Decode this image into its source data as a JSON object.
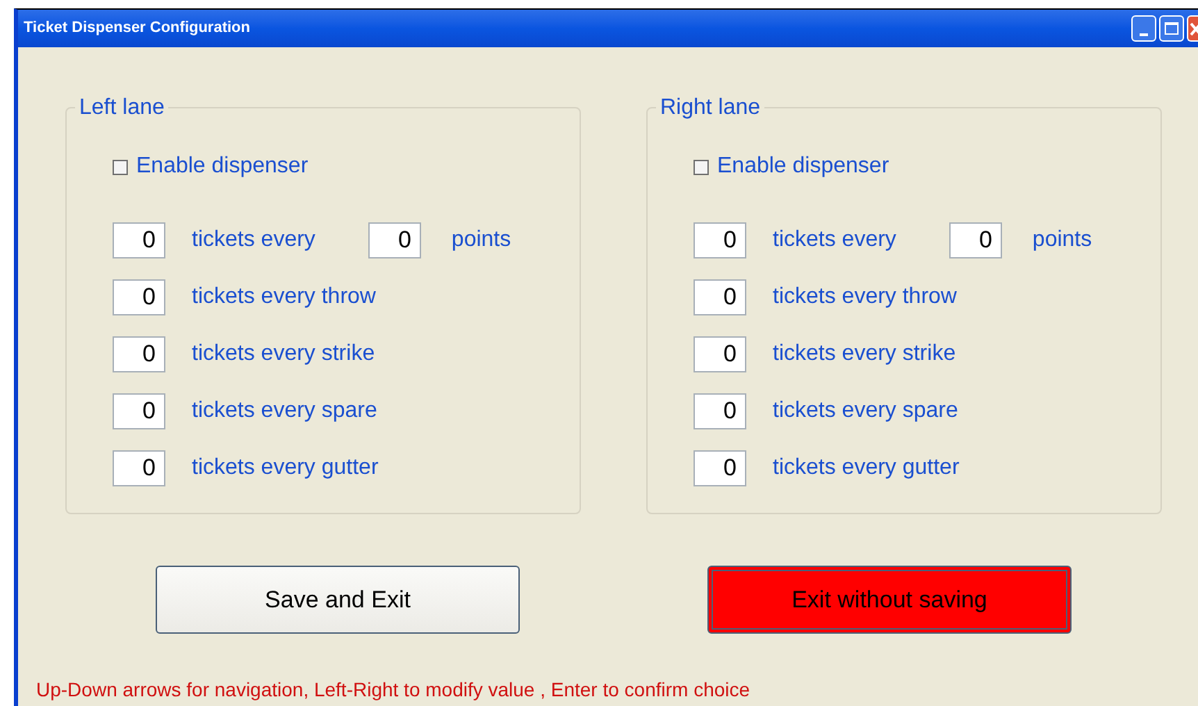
{
  "window": {
    "title": "Ticket Dispenser Configuration"
  },
  "lanes": [
    {
      "title": "Left lane",
      "enable": {
        "label": "Enable dispenser",
        "checked": false
      },
      "rows": [
        {
          "kind": "points",
          "value": "0",
          "label": "tickets every",
          "value_2": "0",
          "suffix": "points"
        },
        {
          "kind": "simple",
          "value": "0",
          "label": "tickets every throw"
        },
        {
          "kind": "simple",
          "value": "0",
          "label": "tickets every strike"
        },
        {
          "kind": "simple",
          "value": "0",
          "label": "tickets every spare"
        },
        {
          "kind": "simple",
          "value": "0",
          "label": "tickets every gutter"
        }
      ]
    },
    {
      "title": "Right lane",
      "enable": {
        "label": "Enable dispenser",
        "checked": false
      },
      "rows": [
        {
          "kind": "points",
          "value": "0",
          "label": "tickets every",
          "value_2": "0",
          "suffix": "points"
        },
        {
          "kind": "simple",
          "value": "0",
          "label": "tickets every throw"
        },
        {
          "kind": "simple",
          "value": "0",
          "label": "tickets every strike"
        },
        {
          "kind": "simple",
          "value": "0",
          "label": "tickets every spare"
        },
        {
          "kind": "simple",
          "value": "0",
          "label": "tickets every gutter"
        }
      ]
    }
  ],
  "buttons": [
    {
      "label": "Save and Exit",
      "selected": false
    },
    {
      "label": "Exit without saving",
      "selected": true
    }
  ],
  "hint": "Up-Down arrows for navigation, Left-Right to modify value , Enter to confirm choice"
}
